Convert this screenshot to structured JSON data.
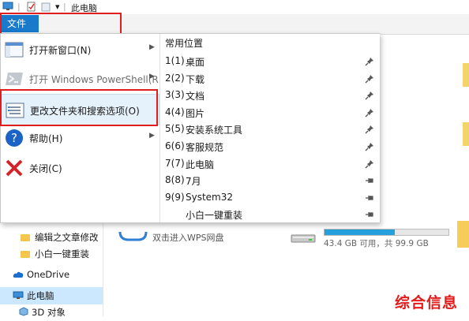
{
  "title_bar": {
    "separator": "|",
    "title": "此电脑",
    "qat_dropdown": "▾"
  },
  "ribbon": {
    "file_tab": "文件"
  },
  "file_menu": {
    "items": [
      {
        "label": "打开新窗口(N)",
        "icon": "window-icon",
        "has_submenu": true,
        "disabled": false
      },
      {
        "label": "打开 Windows PowerShell(R)",
        "icon": "powershell-icon",
        "has_submenu": true,
        "disabled": true
      },
      {
        "label": "更改文件夹和搜索选项(O)",
        "icon": "options-icon",
        "has_submenu": false,
        "disabled": false
      },
      {
        "label": "帮助(H)",
        "icon": "help-icon",
        "has_submenu": true,
        "disabled": false
      },
      {
        "label": "关闭(C)",
        "icon": "close-icon",
        "has_submenu": false,
        "disabled": false
      }
    ],
    "submenu_arrow": "▶",
    "frequent_places": {
      "heading": "常用位置",
      "items": [
        {
          "num": "1(1)",
          "name": "桌面",
          "pin": "pinned"
        },
        {
          "num": "2(2)",
          "name": "下载",
          "pin": "pinned"
        },
        {
          "num": "3(3)",
          "name": "文档",
          "pin": "pinned"
        },
        {
          "num": "4(4)",
          "name": "图片",
          "pin": "pinned"
        },
        {
          "num": "5(5)",
          "name": "安装系统工具",
          "pin": "pinned"
        },
        {
          "num": "6(6)",
          "name": "客服规范",
          "pin": "pinned"
        },
        {
          "num": "7(7)",
          "name": "此电脑",
          "pin": "pinned"
        },
        {
          "num": "8(8)",
          "name": "7月",
          "pin": "unpinned"
        },
        {
          "num": "9(9)",
          "name": "System32",
          "pin": "unpinned"
        },
        {
          "num": "",
          "name": "小白一键重装",
          "pin": "unpinned"
        }
      ]
    }
  },
  "nav_pane": {
    "items": [
      {
        "label": "编辑之文章修改",
        "icon": "folder-icon"
      },
      {
        "label": "小白一键重装",
        "icon": "folder-icon"
      },
      {
        "label": "OneDrive",
        "icon": "cloud-icon"
      },
      {
        "label": "此电脑",
        "icon": "computer-icon",
        "selected": true
      },
      {
        "label": "3D 对象",
        "icon": "cube-icon"
      }
    ]
  },
  "content": {
    "wps_label": "双击进入WPS网盘",
    "drive_free_text": "43.4 GB 可用，共 99.9 GB",
    "drive_used_fraction": 0.57
  },
  "watermark": "综合信息",
  "colors": {
    "file_tab": "#1979ca",
    "highlight": "#e01e1e",
    "drive_fill": "#26a0da",
    "watermark": "#e31b1b"
  }
}
